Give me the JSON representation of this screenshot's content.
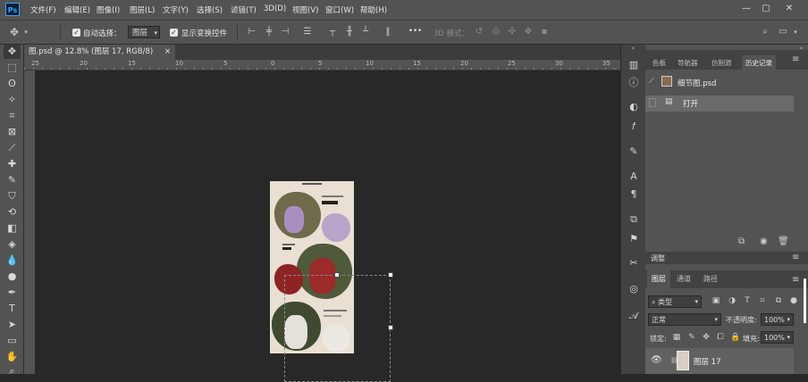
{
  "app": {
    "logo": "Ps"
  },
  "menu": [
    "文件(F)",
    "编辑(E)",
    "图像(I)",
    "图层(L)",
    "文字(Y)",
    "选择(S)",
    "滤镜(T)",
    "3D(D)",
    "视图(V)",
    "窗口(W)",
    "帮助(H)"
  ],
  "window_controls": {
    "minimize": "—",
    "maximize": "▢",
    "close": "✕"
  },
  "options": {
    "auto_select_label": "自动选择：",
    "auto_select_value": "图层",
    "show_transform_label": "显示变换控件",
    "more": "•••",
    "mode_3d_label": "3D 模式："
  },
  "document_tab": {
    "title": "图.psd @ 12.8% (图层 17, RGB/8)",
    "close": "×"
  },
  "ruler_top_labels": [
    "25",
    "20",
    "15",
    "10",
    "5",
    "0",
    "5",
    "10",
    "15",
    "20",
    "25",
    "30",
    "35",
    "40",
    "45"
  ],
  "history_panel": {
    "tabs": [
      "色板",
      "导航器",
      "仿制源",
      "历史记录"
    ],
    "active_tab": "历史记录",
    "snapshot_name": "细节图.psd",
    "items": [
      "打开"
    ]
  },
  "layers_panel": {
    "header": "调整",
    "tabs": [
      "图层",
      "通道",
      "路径"
    ],
    "filter_kind": "类型",
    "blend_mode": "正常",
    "opacity_label": "不透明度:",
    "opacity_value": "100%",
    "lock_label": "锁定:",
    "fill_label": "填充:",
    "fill_value": "100%",
    "layers": [
      {
        "name": "图层 17",
        "visible": true
      }
    ]
  },
  "colors": {
    "chrome": "#535353",
    "dark_panel": "#424242",
    "canvas_bg": "#282828",
    "document_bg": "#e9dfd2",
    "ps_blue": "#31a8ff",
    "highlight_row": "#616161"
  }
}
